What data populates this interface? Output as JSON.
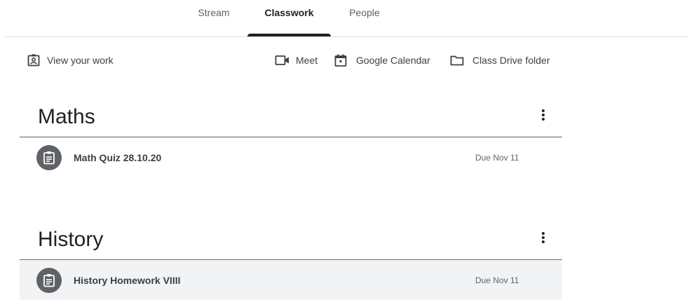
{
  "tabs": [
    {
      "label": "Stream",
      "active": false
    },
    {
      "label": "Classwork",
      "active": true
    },
    {
      "label": "People",
      "active": false
    }
  ],
  "toolbar": {
    "view_work": {
      "label": "View your work",
      "icon": "assignment-ind-icon"
    },
    "meet": {
      "label": "Meet",
      "icon": "video-camera-icon"
    },
    "calendar": {
      "label": "Google Calendar",
      "icon": "calendar-icon"
    },
    "drive": {
      "label": "Class Drive folder",
      "icon": "folder-icon"
    }
  },
  "topics": [
    {
      "title": "Maths",
      "items": [
        {
          "title": "Math Quiz 28.10.20",
          "due": "Due Nov 11",
          "icon": "assignment-icon"
        }
      ]
    },
    {
      "title": "History",
      "items": [
        {
          "title": "History Homework VIIII",
          "due": "Due Nov 11",
          "icon": "assignment-icon"
        }
      ]
    }
  ],
  "colors": {
    "accent": "#202124",
    "muted": "#5f6368",
    "divider": "#e0e0e0",
    "row_hover": "#f1f3f4"
  }
}
